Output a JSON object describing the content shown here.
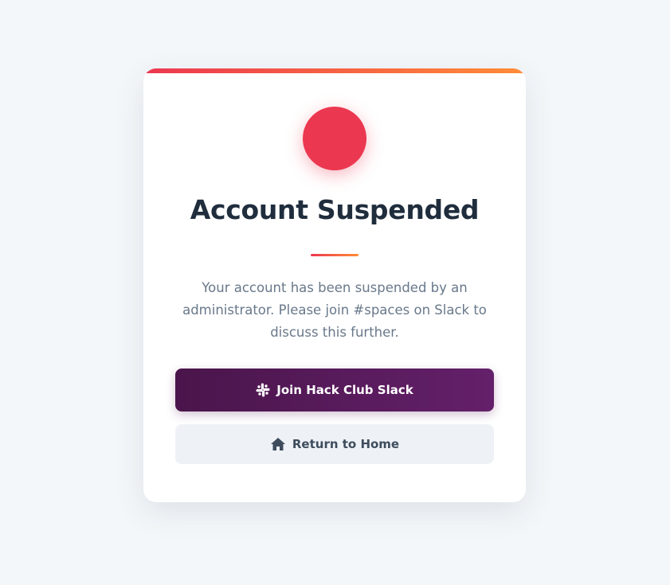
{
  "colors": {
    "accent_red": "#ec3750",
    "accent_orange": "#ff8c37",
    "slack_purple": "#4a154b",
    "background": "#f4f7fa"
  },
  "card": {
    "title": "Account Suspended",
    "status_icon": "red-status-circle",
    "message": "Your account has been suspended by an administrator. Please join #spaces on Slack to discuss this further."
  },
  "actions": {
    "slack": {
      "label": "Join Hack Club Slack",
      "icon": "slack-icon"
    },
    "home": {
      "label": "Return to Home",
      "icon": "home-icon"
    }
  }
}
